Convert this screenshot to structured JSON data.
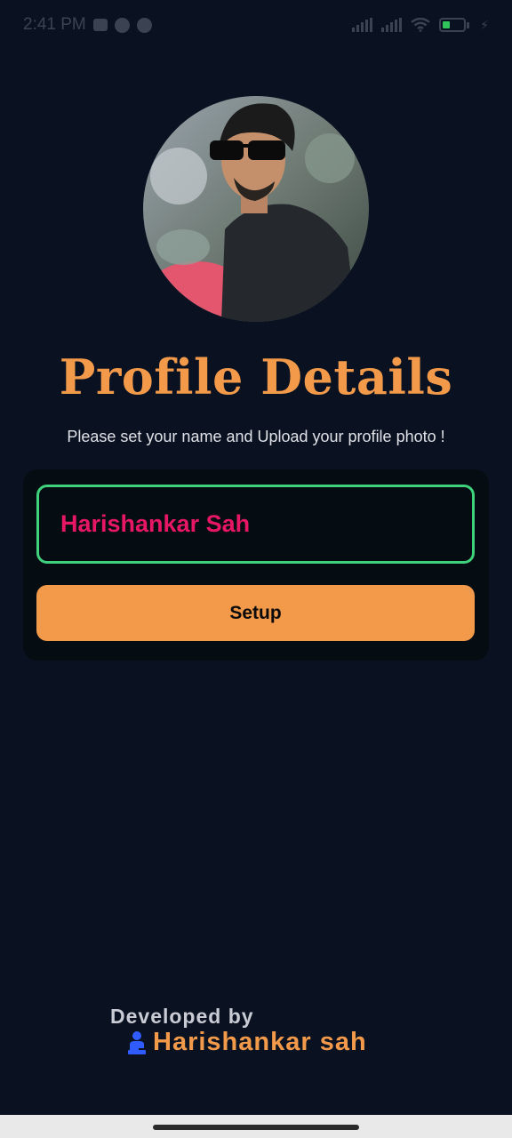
{
  "status_bar": {
    "time": "2:41 PM",
    "battery_level": 0.35,
    "icons": [
      "message-icon",
      "app-icon",
      "app-icon",
      "signal-icon",
      "signal-icon",
      "wifi-icon",
      "battery-icon",
      "charging-icon"
    ]
  },
  "profile": {
    "title": "Profile Details",
    "subtitle": "Please set your name and Upload your profile photo !",
    "name_value": "Harishankar Sah",
    "setup_label": "Setup"
  },
  "footer": {
    "developed_by": "Developed by",
    "developer_name": "Harishankar sah"
  },
  "colors": {
    "background": "#0a1222",
    "accent": "#f2994a",
    "field_border": "#3fd17c",
    "name_text": "#e81764"
  }
}
